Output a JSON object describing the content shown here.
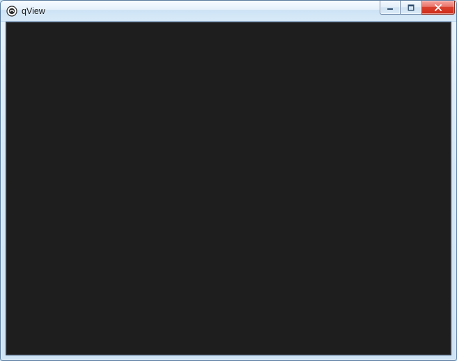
{
  "window": {
    "title": "qView",
    "controls": {
      "minimize_name": "minimize-button",
      "maximize_name": "maximize-button",
      "close_name": "close-button"
    }
  },
  "viewport": {
    "background_color": "#1e1e1e"
  }
}
